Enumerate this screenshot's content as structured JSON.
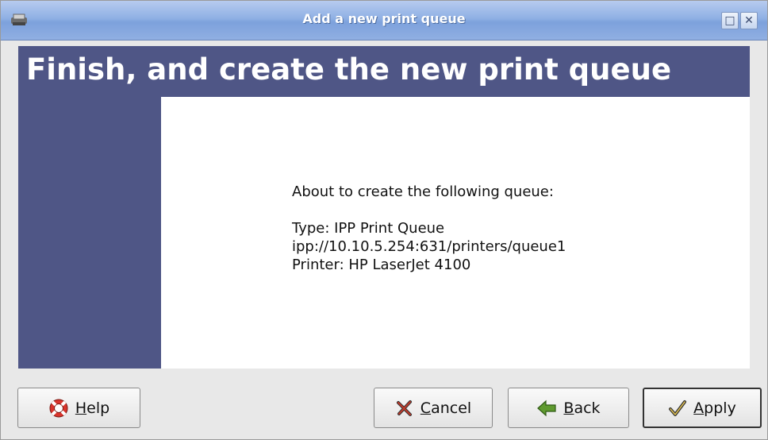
{
  "window": {
    "title": "Add a new print queue",
    "maximize_glyph": "□",
    "close_glyph": "✕"
  },
  "banner": {
    "heading": "Finish, and create the new print queue"
  },
  "content": {
    "intro": "About to create the following queue:",
    "type_line": "Type: IPP Print Queue",
    "uri_line": "ipp://10.10.5.254:631/printers/queue1",
    "printer_line": "Printer: HP LaserJet 4100"
  },
  "buttons": {
    "help": {
      "mnemonic": "H",
      "rest": "elp",
      "icon": "lifebuoy-icon"
    },
    "cancel": {
      "mnemonic": "C",
      "rest": "ancel",
      "icon": "x-icon"
    },
    "back": {
      "mnemonic": "B",
      "rest": "ack",
      "icon": "back-arrow-icon"
    },
    "apply": {
      "mnemonic": "A",
      "rest": "pply",
      "icon": "checkmark-icon"
    }
  },
  "colors": {
    "banner": "#4f5686",
    "titlebar": "#8fb0e4"
  }
}
